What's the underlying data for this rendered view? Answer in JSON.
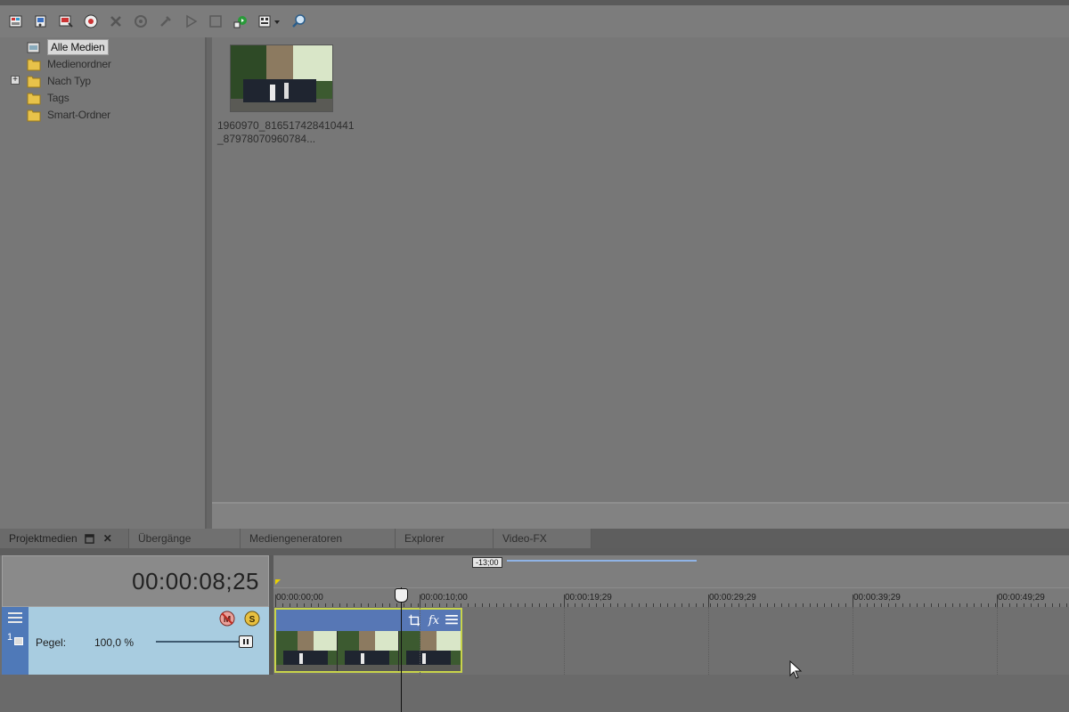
{
  "toolbar": {
    "buttons": [
      {
        "icon": "import-media-icon"
      },
      {
        "icon": "capture-video-icon"
      },
      {
        "icon": "get-media-icon"
      },
      {
        "icon": "extract-audio-icon"
      },
      {
        "icon": "remove-icon"
      },
      {
        "icon": "media-fx-icon"
      },
      {
        "icon": "properties-icon"
      },
      {
        "icon": "play-icon"
      },
      {
        "icon": "stop-icon"
      },
      {
        "icon": "auto-preview-icon"
      },
      {
        "icon": "views-icon"
      },
      {
        "icon": "search-icon"
      }
    ]
  },
  "tree": {
    "items": [
      {
        "label": "Alle Medien",
        "selected": true
      },
      {
        "label": "Medienordner"
      },
      {
        "label": "Nach Typ",
        "expander": "+"
      },
      {
        "label": "Tags"
      },
      {
        "label": "Smart-Ordner"
      }
    ]
  },
  "media": {
    "caption": "1960970_816517428410441_87978070960784..."
  },
  "tabs": [
    {
      "label": "Projektmedien",
      "active": true
    },
    {
      "label": "Übergänge"
    },
    {
      "label": "Mediengeneratoren"
    },
    {
      "label": "Explorer"
    },
    {
      "label": "Video-FX"
    }
  ],
  "timeline": {
    "timecode": "00:00:08;25",
    "loop_marker": "-13;00",
    "ruler_labels": [
      "00:00:00;00",
      "00:00:10;00",
      "00:00:19;29",
      "00:00:29;29",
      "00:00:39;29",
      "00:00:49;29"
    ]
  },
  "track": {
    "number": "1",
    "pegel_label": "Pegel:",
    "pegel_value": "100,0 %",
    "level_fraction": 1.0
  },
  "colors": {
    "track_strip": "#4f79b8",
    "track_header": "#a8cce0",
    "clip_border": "#c8d44a",
    "loop_region": "#8fb3e6"
  }
}
